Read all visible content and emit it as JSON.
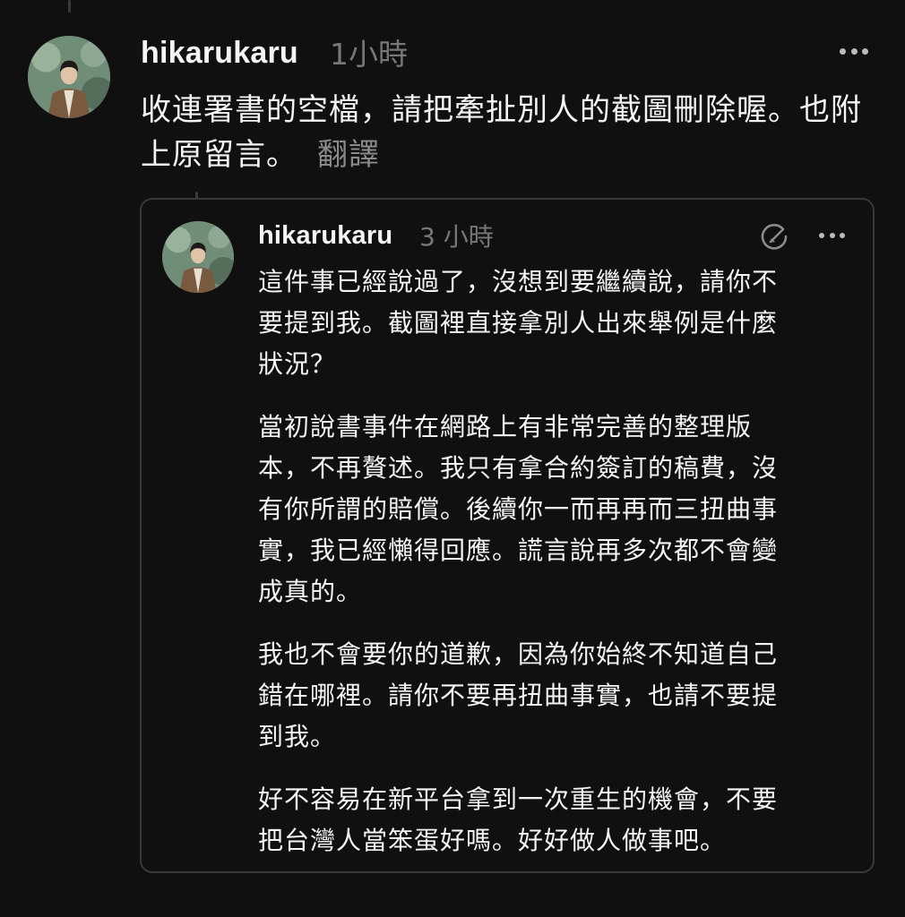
{
  "post": {
    "username": "hikarukaru",
    "timestamp": "1小時",
    "text": "收連署書的空檔，請把牽扯別人的截圖刪除喔。也附上原留言。",
    "translate_label": "翻譯"
  },
  "quoted_post": {
    "username": "hikarukaru",
    "timestamp": "3 小時",
    "paragraphs": [
      "這件事已經說過了，沒想到要繼續說，請你不\n要提到我。截圖裡直接拿別人出來舉例是什麼\n狀況？",
      "當初說書事件在網路上有非常完善的整理版\n本，不再贅述。我只有拿合約簽訂的稿費，沒\n有你所謂的賠償。後續你一而再再而三扭曲事\n實，我已經懶得回應。謊言說再多次都不會變\n成真的。",
      "我也不會要你的道歉，因為你始終不知道自己\n錯在哪裡。請你不要再扭曲事實，也請不要提\n到我。",
      "好不容易在新平台拿到一次重生的機會，不要\n把台灣人當笨蛋好嗎。好好做人做事吧。"
    ]
  },
  "icons": {
    "more": "more-horizontal-icon",
    "edit": "edit-icon",
    "avatar": "avatar"
  },
  "colors": {
    "background": "#101010",
    "text": "#f3f5f7",
    "muted": "#777777",
    "border": "#383838"
  }
}
